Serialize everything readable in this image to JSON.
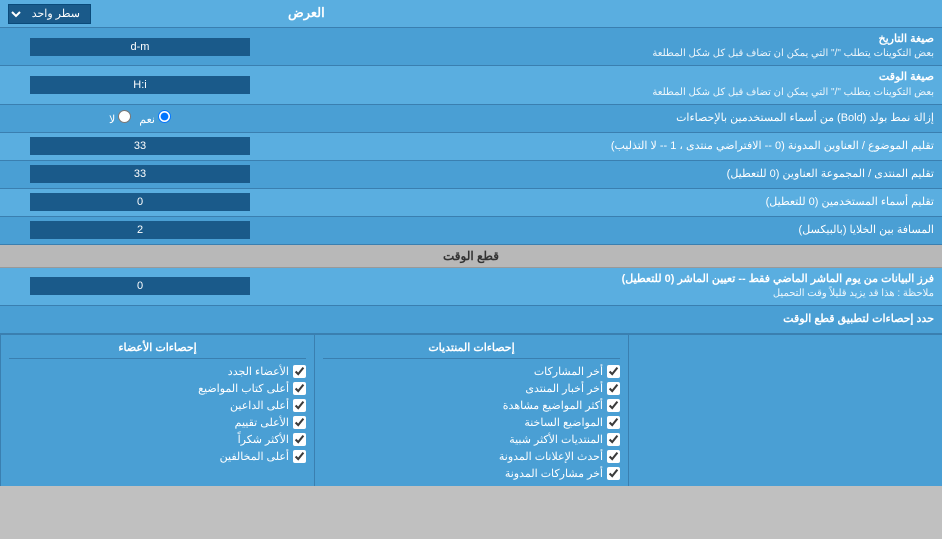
{
  "header": {
    "dropdown_label": "سطر واحد",
    "العرض_label": "العرض"
  },
  "date_row": {
    "label": "صيغة التاريخ",
    "sublabel": "بعض التكوينات يتطلب \"/\" التي يمكن ان تضاف قبل كل شكل المطلعة",
    "value": "d-m"
  },
  "time_row": {
    "label": "صيغة الوقت",
    "sublabel": "بعض التكوينات يتطلب \"/\" التي يمكن ان تضاف قبل كل شكل المطلعة",
    "value": "H:i"
  },
  "bold_row": {
    "label": "إزالة نمط بولد (Bold) من أسماء المستخدمين بالإحصاءات",
    "radio_yes": "نعم",
    "radio_no": "لا",
    "selected": "نعم"
  },
  "subject_row": {
    "label": "تقليم الموضوع / العناوين المدونة (0 -- الافتراضي منتدى ، 1 -- لا التذليب)",
    "value": "33"
  },
  "forum_row": {
    "label": "تقليم المنتدى / المجموعة العناوين (0 للتعطيل)",
    "value": "33"
  },
  "usernames_row": {
    "label": "تقليم أسماء المستخدمين (0 للتعطيل)",
    "value": "0"
  },
  "gap_row": {
    "label": "المسافة بين الخلايا (بالبيكسل)",
    "value": "2"
  },
  "time_section": {
    "title": "قطع الوقت"
  },
  "time_filter_row": {
    "label": "فرز البيانات من يوم الماشر الماضي فقط -- تعيين الماشر (0 للتعطيل)",
    "sublabel": "ملاحظة : هذا قد يزيد قليلاً وقت التحميل",
    "value": "0"
  },
  "stats_limit_row": {
    "label": "حدد إحصاءات لتطبيق قطع الوقت"
  },
  "checkboxes": {
    "col1": {
      "header": "إحصاءات المنتديات",
      "items": [
        "أخر المشاركات",
        "أخر أخبار المنتدى",
        "أكثر المواضيع مشاهدة",
        "المواضيع الساخنة",
        "المنتديات الأكثر شبية",
        "أحدث الإعلانات المدونة",
        "أخر مشاركات المدونة"
      ]
    },
    "col2": {
      "header": "إحصاءات الأعضاء",
      "items": [
        "الأعضاء الجدد",
        "أعلى كتاب المواضيع",
        "أعلى الداعين",
        "الأعلى تقييم",
        "الأكثر شكراً",
        "أعلى المخالفين"
      ]
    }
  }
}
